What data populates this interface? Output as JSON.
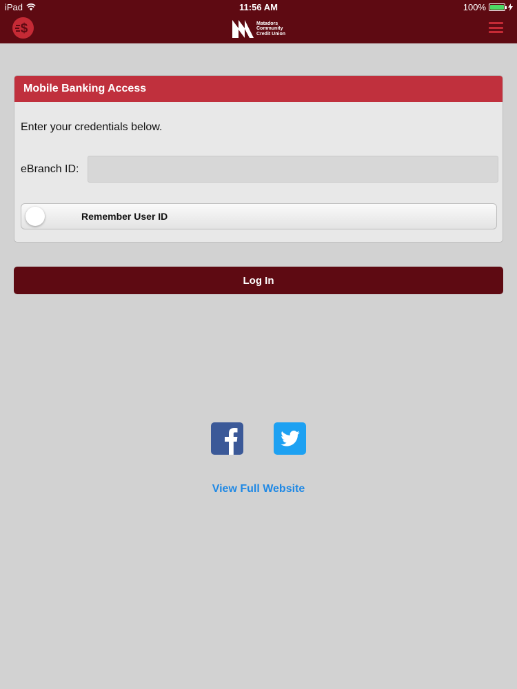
{
  "status_bar": {
    "carrier": "iPad",
    "time": "11:56 AM",
    "battery": "100%",
    "battery_level": 1.0
  },
  "nav": {
    "logo_lines": [
      "Matadors",
      "Community",
      "Credit Union"
    ]
  },
  "card": {
    "title": "Mobile Banking Access",
    "intro": "Enter your credentials below.",
    "field_label": "eBranch ID:",
    "field_value": "",
    "remember_label": "Remember User ID",
    "remember_on": false
  },
  "login_label": "Log In",
  "full_site_label": "View Full Website",
  "colors": {
    "nav_bg": "#5e0a12",
    "header_red": "#c0303d",
    "link_blue": "#1e88e5",
    "facebook": "#3b5998",
    "twitter": "#1da1f2"
  }
}
